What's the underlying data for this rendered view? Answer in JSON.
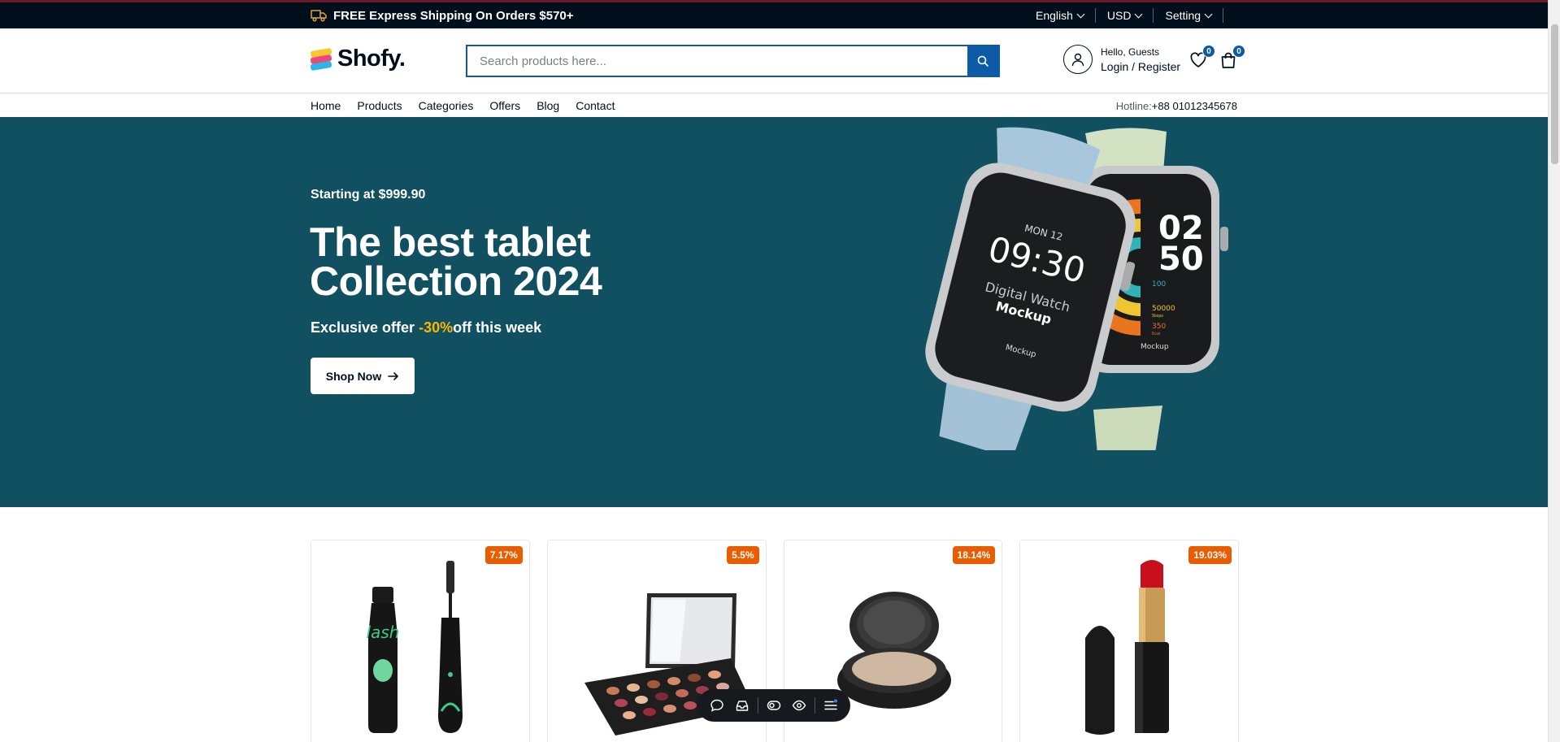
{
  "topbar": {
    "shipping_text": "FREE Express Shipping On Orders $570+",
    "language": "English",
    "currency": "USD",
    "setting": "Setting"
  },
  "header": {
    "logo_text": "Shofy.",
    "search_placeholder": "Search products here...",
    "greeting": "Hello, Guests",
    "login_register": "Login / Register",
    "wishlist_count": "0",
    "cart_count": "0"
  },
  "nav": {
    "items": [
      "Home",
      "Products",
      "Categories",
      "Offers",
      "Blog",
      "Contact"
    ],
    "hotline_label": "Hotline:",
    "hotline_number": "+88 01012345678"
  },
  "hero": {
    "pretitle": "Starting at $999.90",
    "title_line1": "The best tablet",
    "title_line2": "Collection 2024",
    "offer_prefix": "Exclusive offer",
    "offer_percent": "-30%",
    "offer_suffix": "off this week",
    "button_label": "Shop Now",
    "background_color": "#115061",
    "watch_left": {
      "day": "MON 12",
      "time": "09:30",
      "line1": "Digital Watch",
      "line2": "Mockup",
      "brand": "Mockup"
    },
    "watch_right": {
      "hour": "02",
      "minute": "50",
      "stat1": "100",
      "stat2": "50000",
      "stat2_label": "Steps",
      "stat3": "350",
      "stat3_label": "Kcal",
      "brand": "Mockup"
    }
  },
  "products": [
    {
      "discount": "7.17%",
      "icon": "mascara-product"
    },
    {
      "discount": "5.5%",
      "icon": "eyeshadow-palette-product"
    },
    {
      "discount": "18.14%",
      "icon": "compact-powder-product"
    },
    {
      "discount": "19.03%",
      "icon": "lipstick-product"
    }
  ],
  "colors": {
    "accent_blue": "#0d5aa7",
    "discount_orange": "#e95c00",
    "offer_yellow": "#fcb700",
    "topbar_bg": "#010f1c"
  }
}
